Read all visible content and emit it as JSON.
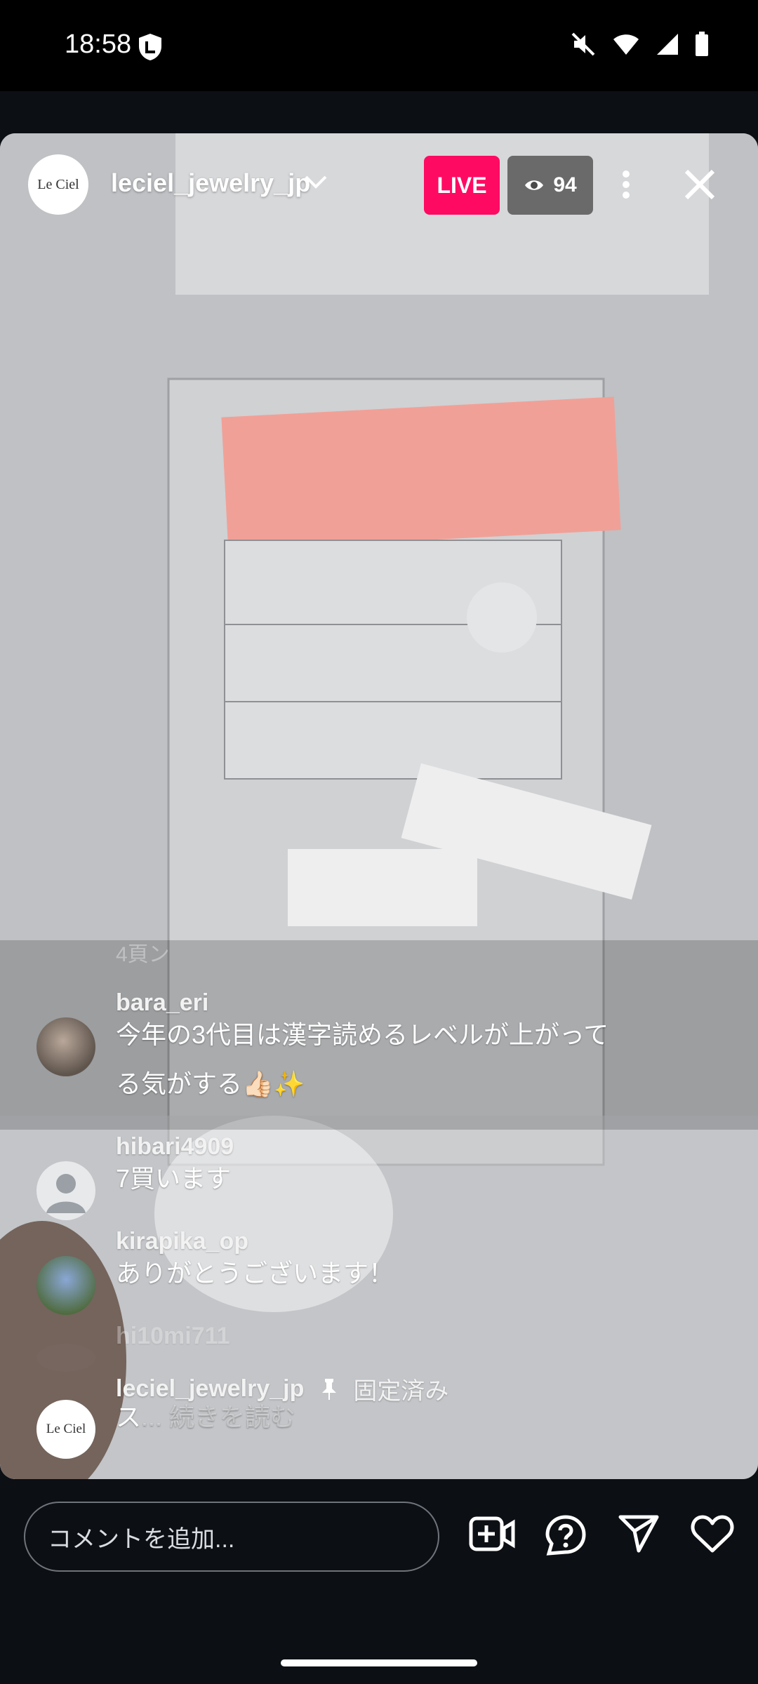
{
  "status": {
    "time": "18:58"
  },
  "header": {
    "host_name": "leciel_jewelry_jp",
    "avatar_text": "Le Ciel",
    "live_label": "LIVE",
    "viewer_count": "94"
  },
  "comments": {
    "faded_top": "4頁ン",
    "items": [
      {
        "user": "bara_eri",
        "text_line1": "今年の3代目は漢字読めるレベルが上がって",
        "text_line2": "る気がする👍🏻✨"
      },
      {
        "user": "hibari4909",
        "text_line1": "7買います"
      },
      {
        "user": "kirapika_op",
        "text_line1": "ありがとうございます！"
      },
      {
        "user": "hi10mi711"
      },
      {
        "user": "leciel_jewelry_jp",
        "pinned_label": "固定済み",
        "text_line1": "ス",
        "more": "... 続きを読む",
        "avatar_text": "Le Ciel"
      }
    ]
  },
  "composer": {
    "placeholder": "コメントを追加..."
  },
  "icons": {
    "add_video": "video-plus-icon",
    "question": "question-bubble-icon",
    "send": "send-icon",
    "like": "heart-icon"
  },
  "colors": {
    "live_badge": "#ff0a63",
    "background": "#0c0f14"
  }
}
